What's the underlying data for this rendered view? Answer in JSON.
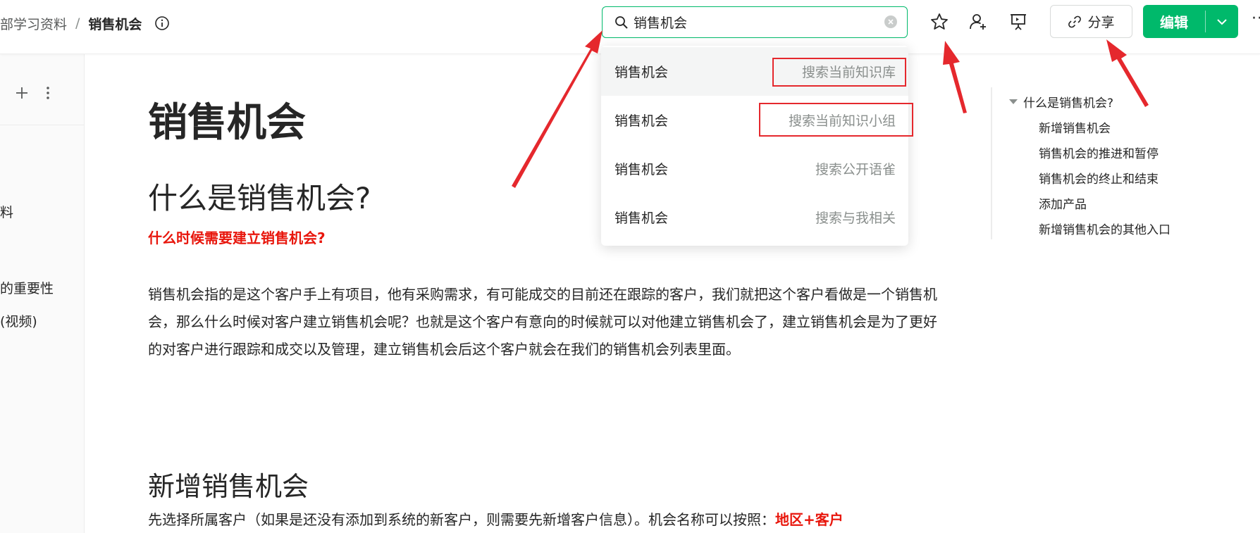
{
  "header": {
    "breadcrumb_parent": "部学习资料",
    "breadcrumb_separator": "/",
    "breadcrumb_current": "销售机会",
    "search_value": "销售机会",
    "share_label": "分享",
    "edit_label": "编辑",
    "more_label": "···"
  },
  "search_dropdown": {
    "items": [
      {
        "term": "销售机会",
        "scope": "搜索当前知识库"
      },
      {
        "term": "销售机会",
        "scope": "搜索当前知识小组"
      },
      {
        "term": "销售机会",
        "scope": "搜索公开语雀"
      },
      {
        "term": "销售机会",
        "scope": "搜索与我相关"
      }
    ]
  },
  "sidebar": {
    "items": [
      "料",
      "的重要性",
      "(视频)"
    ]
  },
  "document": {
    "title": "销售机会",
    "h2_what": "什么是销售机会?",
    "red_note": "什么时候需要建立销售机会?",
    "paragraph": "销售机会指的是这个客户手上有项目，他有采购需求，有可能成交的目前还在跟踪的客户，我们就把这个客户看做是一个销售机会，那么什么时候对客户建立销售机会呢？也就是这个客户有意向的时候就可以对他建立销售机会了，建立销售机会是为了更好的对客户进行跟踪和成交以及管理，建立销售机会后这个客户就会在我们的销售机会列表里面。",
    "h2_add": "新增销售机会",
    "para2_text": "先选择所属客户（如果是还没有添加到系统的新客户，则需要先新增客户信息）。机会名称可以按照：",
    "para2_highlight": "地区+客户"
  },
  "toc": {
    "items": [
      "什么是销售机会?",
      "新增销售机会",
      "销售机会的推进和暂停",
      "销售机会的终止和结束",
      "添加产品",
      "新增销售机会的其他入口"
    ]
  },
  "colors": {
    "accent": "#00b96b",
    "annotation": "#e5282d",
    "red_text": "#e8160c"
  }
}
